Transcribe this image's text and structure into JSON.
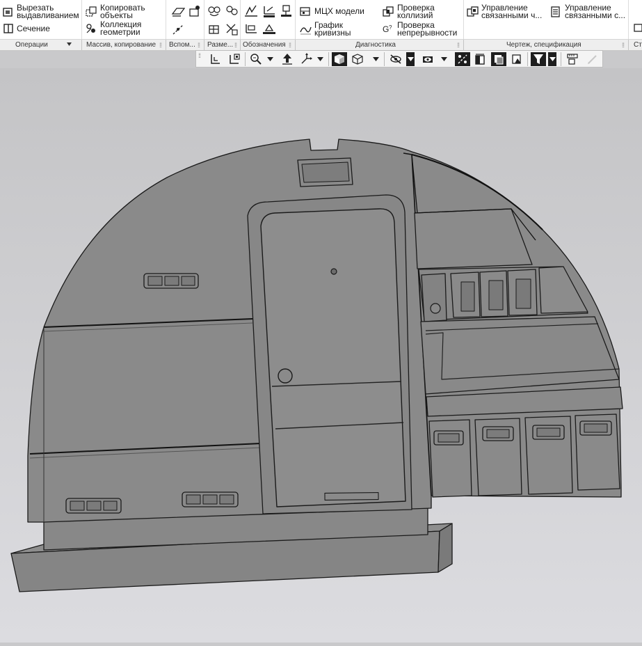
{
  "ribbon": {
    "operations": {
      "cut_extrude": "Вырезать\nвыдавливанием",
      "section": "Сечение",
      "group_label": "Операции"
    },
    "array": {
      "copy_objects": "Копировать\nобъекты",
      "geometry_collection": "Коллекция\nгеометрии",
      "group_label": "Массив, копирование"
    },
    "aux": {
      "group_label": "Вспом..."
    },
    "dimensions": {
      "group_label": "Разме..."
    },
    "designations": {
      "group_label": "Обозначения"
    },
    "diagnostics": {
      "mcx_model": "МЦХ модели",
      "curvature_graph": "График\nкривизны",
      "collision_check": "Проверка\nколлизий",
      "continuity_check": "Проверка\nнепрерывности",
      "group_label": "Диагностика"
    },
    "drawing": {
      "manage_linked_1": "Управление\nсвязанными ч...",
      "manage_linked_2": "Управление\nсвязанными с...",
      "group_label": "Чертеж, спецификация"
    },
    "last_group": {
      "group_label": "Ст"
    }
  },
  "colors": {
    "model_face": "#8a8a8a",
    "model_edge": "#1a1a1a",
    "viewport_bg_top": "#c4c4c6",
    "viewport_bg_bottom": "#dcdce0",
    "toolbar_dark": "#1e1e1e",
    "icon_blue": "#1f5fb5"
  },
  "view_toolbar": {
    "buttons": [
      "grip",
      "orient-icon",
      "view-orient-icon",
      "zoom-icon",
      "zoom-menu",
      "rotate-icon",
      "pan-icon",
      "pan-menu",
      "shaded-icon",
      "wireframe-icon",
      "display-menu",
      "hide-icon",
      "hide-menu",
      "visibility-icon",
      "visibility-menu",
      "constraints-icon",
      "section-view-icon",
      "perspective-icon",
      "render-icon",
      "filter-icon",
      "filter-menu",
      "measure-icon",
      "disabled-pen-icon"
    ]
  }
}
